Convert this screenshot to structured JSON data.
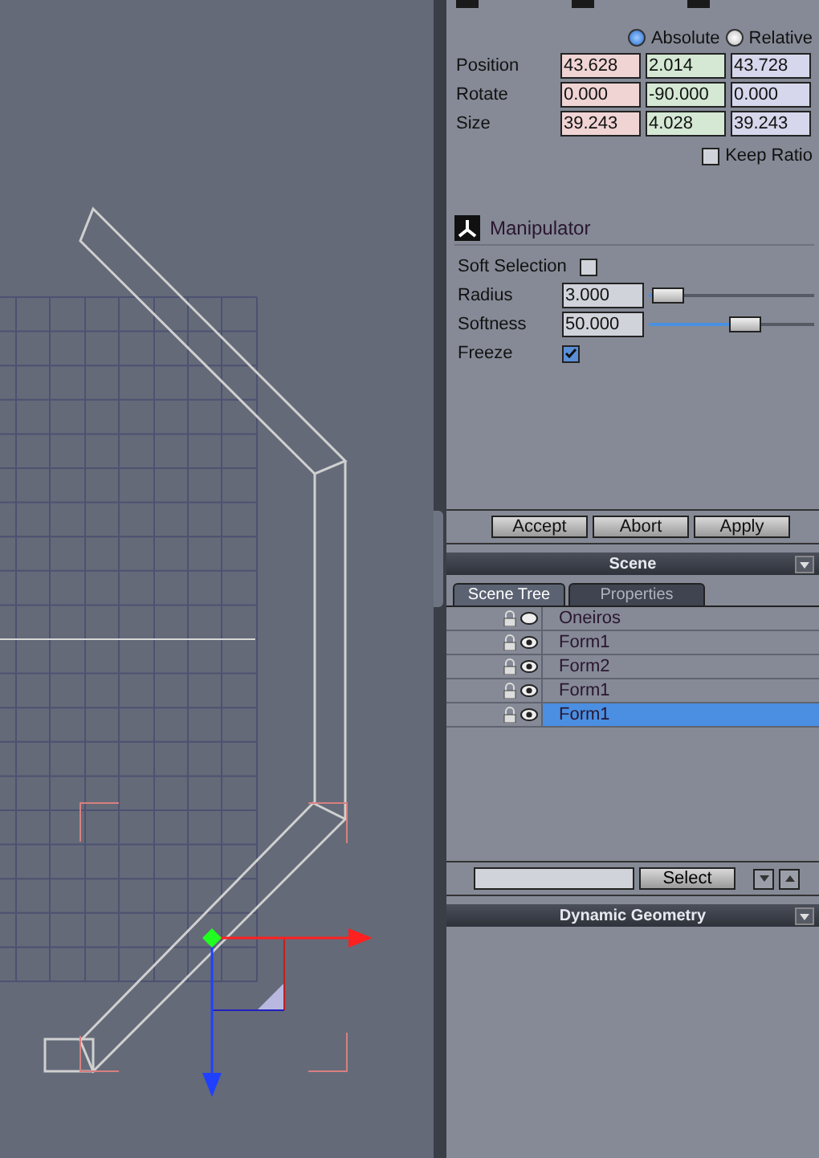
{
  "transform": {
    "modes": [
      {
        "label": "Absolute",
        "selected": true
      },
      {
        "label": "Relative",
        "selected": false
      }
    ],
    "rows": [
      {
        "label": "Position",
        "values": [
          "43.628",
          "2.014",
          "43.728"
        ]
      },
      {
        "label": "Rotate",
        "values": [
          "0.000",
          "-90.000",
          "0.000"
        ]
      },
      {
        "label": "Size",
        "values": [
          "39.243",
          "4.028",
          "39.243"
        ]
      }
    ],
    "keep_ratio": {
      "label": "Keep Ratio",
      "checked": false
    }
  },
  "manipulator": {
    "title": "Manipulator",
    "soft_selection": {
      "label": "Soft Selection",
      "checked": false
    },
    "sliders": [
      {
        "label": "Radius",
        "value": "3.000",
        "level": 0.04
      },
      {
        "label": "Softness",
        "value": "50.000",
        "level": 0.5
      }
    ],
    "freeze": {
      "label": "Freeze",
      "checked": true
    }
  },
  "buttons": [
    "Accept",
    "Abort",
    "Apply"
  ],
  "scene": {
    "title": "Scene",
    "tabs": [
      {
        "label": "Scene Tree",
        "selected": true
      },
      {
        "label": "Properties",
        "selected": false
      }
    ],
    "rows": [
      {
        "name": "Oneiros",
        "visible": false,
        "selected": false
      },
      {
        "name": "Form1",
        "visible": true,
        "selected": false
      },
      {
        "name": "Form2",
        "visible": true,
        "selected": false
      },
      {
        "name": "Form1",
        "visible": true,
        "selected": false
      },
      {
        "name": "Form1",
        "visible": true,
        "selected": true
      }
    ],
    "select_button": "Select"
  },
  "dynamic_geometry": {
    "title": "Dynamic Geometry"
  }
}
